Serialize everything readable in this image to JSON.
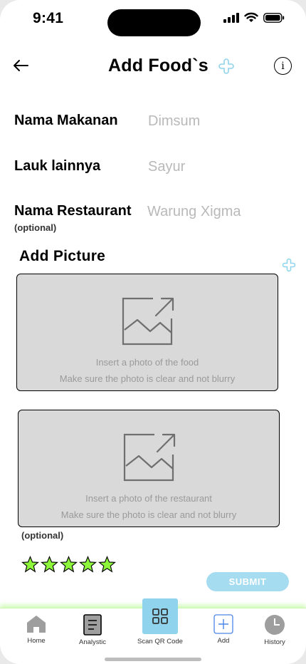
{
  "status_bar": {
    "time": "9:41"
  },
  "header": {
    "title": "Add Food`s"
  },
  "form": {
    "food_name": {
      "label": "Nama Makanan",
      "placeholder": "Dimsum"
    },
    "side_dish": {
      "label": "Lauk lainnya",
      "placeholder": "Sayur"
    },
    "restaurant": {
      "label": "Nama Restaurant",
      "sublabel": "(optional)",
      "placeholder": "Warung Xigma"
    }
  },
  "pictures": {
    "title": "Add Picture",
    "food_photo": {
      "line1": "Insert a photo of the food",
      "line2": "Make sure the photo is clear and not blurry"
    },
    "restaurant_photo": {
      "line1": "Insert a photo of the restaurant",
      "line2": "Make sure the photo is clear and not blurry"
    },
    "optional_note": "(optional)"
  },
  "rating": {
    "value": 5,
    "max": 5,
    "star_color": "#8df53a"
  },
  "submit": {
    "label": "SUBMIT",
    "color": "#a6dcef"
  },
  "nav": {
    "items": [
      {
        "label": "Home",
        "icon": "home-icon"
      },
      {
        "label": "Analystic",
        "icon": "document-icon"
      },
      {
        "label": "Scan QR Code",
        "icon": "qr-grid-icon"
      },
      {
        "label": "Add",
        "icon": "add-square-icon"
      },
      {
        "label": "History",
        "icon": "clock-icon"
      }
    ]
  },
  "colors": {
    "accent": "#8fd3ec",
    "nav_glow": "#7cf03d"
  }
}
